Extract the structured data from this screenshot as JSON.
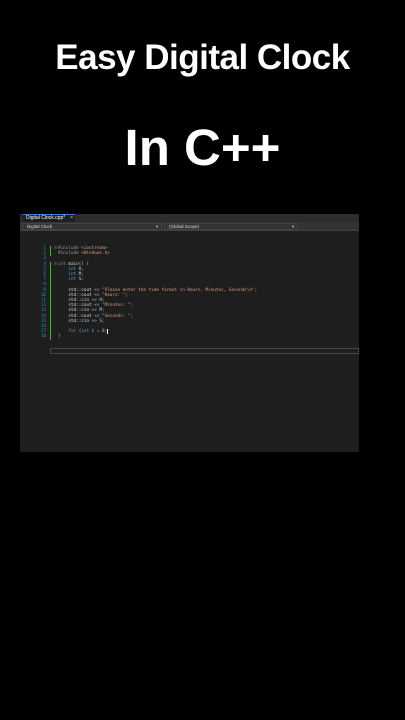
{
  "overlay": {
    "title_line1": "Easy Digital Clock",
    "title_line2": "In C++"
  },
  "ide": {
    "tab_label": "Digital Clock.cpp*",
    "tab_close_icon": "close-icon",
    "project_dropdown": "Digital Clock",
    "scope_dropdown": "(Global Scope)",
    "dropdown_icon": "chevron-down-icon",
    "colors": {
      "background": "#1e1e1e",
      "line_numbers": "#2b91af",
      "keyword": "#569cd6",
      "string": "#d69d85",
      "change_bar": "#57a64a"
    }
  },
  "code": {
    "lines": [
      {
        "num": "1",
        "marker": "⊟",
        "text": "#include <iostream>"
      },
      {
        "num": "2",
        "marker": "",
        "text": "#include <Windows.h>"
      },
      {
        "num": "3",
        "marker": "",
        "text": ""
      },
      {
        "num": "4",
        "marker": "⊟",
        "text": "int main() {"
      },
      {
        "num": "5",
        "marker": "",
        "text": "    int H,"
      },
      {
        "num": "6",
        "marker": "",
        "text": "    int M,"
      },
      {
        "num": "7",
        "marker": "",
        "text": "    int S;"
      },
      {
        "num": "8",
        "marker": "",
        "text": ""
      },
      {
        "num": "9",
        "marker": "",
        "text": "    std::cout << \"Please enter the time format in Hours, Minutes, Seconds\\n\";"
      },
      {
        "num": "10",
        "marker": "",
        "text": "    std::cout << \"Hours: \";"
      },
      {
        "num": "11",
        "marker": "",
        "text": "    std::cin >> H;"
      },
      {
        "num": "12",
        "marker": "",
        "text": "    std::cout << \"Minutes: \";"
      },
      {
        "num": "13",
        "marker": "",
        "text": "    std::cin >> M;"
      },
      {
        "num": "14",
        "marker": "",
        "text": "    std::cout << \"Seconds: \";"
      },
      {
        "num": "15",
        "marker": "",
        "text": "    std::cin >> S;"
      },
      {
        "num": "16",
        "marker": "",
        "text": ""
      },
      {
        "num": "17",
        "marker": "",
        "text": "    for (int i = 0;"
      },
      {
        "num": "18",
        "marker": "",
        "text": "}"
      }
    ]
  }
}
